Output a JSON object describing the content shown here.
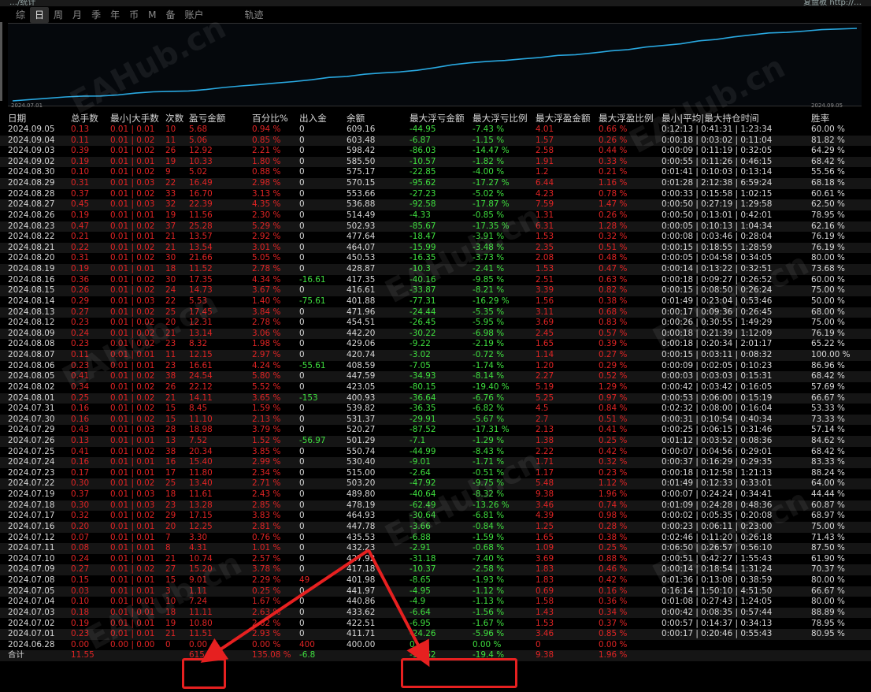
{
  "topbar": {
    "left_title": "…/统计",
    "right_title": "复盘板 http://…"
  },
  "tabs": [
    "综",
    "日",
    "周",
    "月",
    "季",
    "年",
    "币",
    "M",
    "备",
    "账户",
    "轨迹"
  ],
  "active_tab": "日",
  "chart": {
    "start_date": "2024.07.01",
    "end_date": "2024.09.05",
    "line_color": "#29a8e0"
  },
  "watermark": "EAHub.cn",
  "columns": [
    "日期",
    "总手数",
    "最小|大手数",
    "次数",
    "盈亏金额",
    "百分比%",
    "出入金",
    "余额",
    "最大浮亏金额",
    "最大浮亏比例",
    "最大浮盈金额",
    "最大浮盈比例",
    "最小|平均|最大持仓时间",
    "胜率"
  ],
  "rows": [
    [
      "2024.09.05",
      "0.13",
      "0.01 | 0.01",
      "10",
      "5.68",
      "0.94 %",
      "0",
      "609.16",
      "-44.95",
      "-7.43 %",
      "4.01",
      "0.66 %",
      "0:12:13 | 0:41:31 | 1:23:34",
      "60.00 %"
    ],
    [
      "2024.09.04",
      "0.11",
      "0.01 | 0.02",
      "11",
      "5.06",
      "0.85 %",
      "0",
      "603.48",
      "-6.87",
      "-1.15 %",
      "1.57",
      "0.26 %",
      "0:00:18 | 0:03:02 | 0:11:04",
      "81.82 %"
    ],
    [
      "2024.09.03",
      "0.39",
      "0.01 | 0.02",
      "26",
      "12.92",
      "2.21 %",
      "0",
      "598.42",
      "-86.03",
      "-14.47 %",
      "2.58",
      "0.44 %",
      "0:00:09 | 0:11:19 | 0:32:05",
      "64.29 %"
    ],
    [
      "2024.09.02",
      "0.19",
      "0.01 | 0.01",
      "19",
      "10.33",
      "1.80 %",
      "0",
      "585.50",
      "-10.57",
      "-1.82 %",
      "1.91",
      "0.33 %",
      "0:00:55 | 0:11:26 | 0:46:15",
      "68.42 %"
    ],
    [
      "2024.08.30",
      "0.10",
      "0.01 | 0.02",
      "9",
      "5.02",
      "0.88 %",
      "0",
      "575.17",
      "-22.85",
      "-4.00 %",
      "1.2",
      "0.21 %",
      "0:01:41 | 0:10:03 | 0:13:14",
      "55.56 %"
    ],
    [
      "2024.08.29",
      "0.31",
      "0.01 | 0.03",
      "22",
      "16.49",
      "2.98 %",
      "0",
      "570.15",
      "-95.62",
      "-17.27 %",
      "6.44",
      "1.16 %",
      "0:01:28 | 2:12:38 | 6:59:24",
      "68.18 %"
    ],
    [
      "2024.08.28",
      "0.37",
      "0.01 | 0.02",
      "33",
      "16.70",
      "3.13 %",
      "0",
      "553.66",
      "-27.23",
      "-5.02 %",
      "4.23",
      "0.78 %",
      "0:00:33 | 0:15:58 | 1:02:15",
      "60.61 %"
    ],
    [
      "2024.08.27",
      "0.45",
      "0.01 | 0.03",
      "32",
      "22.39",
      "4.35 %",
      "0",
      "536.88",
      "-92.58",
      "-17.87 %",
      "7.59",
      "1.47 %",
      "0:00:50 | 0:27:19 | 1:29:58",
      "62.50 %"
    ],
    [
      "2024.08.26",
      "0.19",
      "0.01 | 0.01",
      "19",
      "11.56",
      "2.30 %",
      "0",
      "514.49",
      "-4.33",
      "-0.85 %",
      "1.31",
      "0.26 %",
      "0:00:50 | 0:13:01 | 0:42:01",
      "78.95 %"
    ],
    [
      "2024.08.23",
      "0.47",
      "0.01 | 0.02",
      "37",
      "25.28",
      "5.29 %",
      "0",
      "502.93",
      "-85.67",
      "-17.35 %",
      "6.31",
      "1.28 %",
      "0:00:05 | 0:10:13 | 1:04:34",
      "62.16 %"
    ],
    [
      "2024.08.22",
      "0.21",
      "0.01 | 0.01",
      "21",
      "13.57",
      "2.92 %",
      "0",
      "477.64",
      "-18.47",
      "-3.91 %",
      "1.53",
      "0.32 %",
      "0:00:08 | 0:03:46 | 0:28:04",
      "76.19 %"
    ],
    [
      "2024.08.21",
      "0.22",
      "0.01 | 0.02",
      "21",
      "13.54",
      "3.01 %",
      "0",
      "464.07",
      "-15.99",
      "-3.48 %",
      "2.35",
      "0.51 %",
      "0:00:15 | 0:18:55 | 1:28:59",
      "76.19 %"
    ],
    [
      "2024.08.20",
      "0.31",
      "0.01 | 0.02",
      "30",
      "21.66",
      "5.05 %",
      "0",
      "450.53",
      "-16.35",
      "-3.73 %",
      "2.08",
      "0.48 %",
      "0:00:05 | 0:04:58 | 0:34:05",
      "80.00 %"
    ],
    [
      "2024.08.19",
      "0.19",
      "0.01 | 0.01",
      "18",
      "11.52",
      "2.78 %",
      "0",
      "428.87",
      "-10.3",
      "-2.41 %",
      "1.53",
      "0.47 %",
      "0:00:14 | 0:13:22 | 0:32:51",
      "73.68 %"
    ],
    [
      "2024.08.16",
      "0.36",
      "0.01 | 0.02",
      "30",
      "17.35",
      "4.34 %",
      "-16.61",
      "417.35",
      "-40.16",
      "-9.85 %",
      "2.51",
      "0.63 %",
      "0:00:18 | 0:09:27 | 0:26:52",
      "60.00 %"
    ],
    [
      "2024.08.15",
      "0.26",
      "0.01 | 0.02",
      "24",
      "14.73",
      "3.67 %",
      "0",
      "416.61",
      "-33.87",
      "-8.21 %",
      "3.39",
      "0.82 %",
      "0:00:15 | 0:08:50 | 0:26:24",
      "75.00 %"
    ],
    [
      "2024.08.14",
      "0.29",
      "0.01 | 0.03",
      "22",
      "5.53",
      "1.40 %",
      "-75.61",
      "401.88",
      "-77.31",
      "-16.29 %",
      "1.56",
      "0.38 %",
      "0:01:49 | 0:23:04 | 0:53:46",
      "50.00 %"
    ],
    [
      "2024.08.13",
      "0.27",
      "0.01 | 0.02",
      "25",
      "17.45",
      "3.84 %",
      "0",
      "471.96",
      "-24.44",
      "-5.35 %",
      "3.11",
      "0.68 %",
      "0:00:17 | 0:09:36 | 0:26:45",
      "68.00 %"
    ],
    [
      "2024.08.12",
      "0.23",
      "0.01 | 0.02",
      "20",
      "12.31",
      "2.78 %",
      "0",
      "454.51",
      "-26.45",
      "-5.95 %",
      "3.69",
      "0.83 %",
      "0:00:26 | 0:30:55 | 1:49:29",
      "75.00 %"
    ],
    [
      "2024.08.09",
      "0.24",
      "0.01 | 0.02",
      "21",
      "13.14",
      "3.06 %",
      "0",
      "442.20",
      "-30.22",
      "-6.98 %",
      "2.45",
      "0.57 %",
      "0:00:18 | 0:21:39 | 1:12:09",
      "76.19 %"
    ],
    [
      "2024.08.08",
      "0.23",
      "0.01 | 0.02",
      "23",
      "8.32",
      "1.98 %",
      "0",
      "429.06",
      "-9.22",
      "-2.19 %",
      "1.65",
      "0.39 %",
      "0:00:18 | 0:20:34 | 2:01:17",
      "65.22 %"
    ],
    [
      "2024.08.07",
      "0.11",
      "0.01 | 0.01",
      "11",
      "12.15",
      "2.97 %",
      "0",
      "420.74",
      "-3.02",
      "-0.72 %",
      "1.14",
      "0.27 %",
      "0:00:15 | 0:03:11 | 0:08:32",
      "100.00 %"
    ],
    [
      "2024.08.06",
      "0.23",
      "0.01 | 0.01",
      "23",
      "16.61",
      "4.24 %",
      "-55.61",
      "408.59",
      "-7.05",
      "-1.74 %",
      "1.20",
      "0.29 %",
      "0:00:09 | 0:02:05 | 0:10:23",
      "86.96 %"
    ],
    [
      "2024.08.05",
      "0.41",
      "0.01 | 0.02",
      "38",
      "24.54",
      "5.80 %",
      "0",
      "447.59",
      "-34.93",
      "-8.14 %",
      "2.27",
      "0.52 %",
      "0:00:03 | 0:03:03 | 0:15:31",
      "68.42 %"
    ],
    [
      "2024.08.02",
      "0.34",
      "0.01 | 0.02",
      "26",
      "22.12",
      "5.52 %",
      "0",
      "423.05",
      "-80.15",
      "-19.40 %",
      "5.19",
      "1.29 %",
      "0:00:42 | 0:03:42 | 0:16:05",
      "57.69 %"
    ],
    [
      "2024.08.01",
      "0.25",
      "0.01 | 0.02",
      "21",
      "14.11",
      "3.65 %",
      "-153",
      "400.93",
      "-36.64",
      "-6.76 %",
      "5.25",
      "0.97 %",
      "0:00:53 | 0:06:00 | 0:15:19",
      "66.67 %"
    ],
    [
      "2024.07.31",
      "0.16",
      "0.01 | 0.02",
      "15",
      "8.45",
      "1.59 %",
      "0",
      "539.82",
      "-36.35",
      "-6.82 %",
      "4.5",
      "0.84 %",
      "0:02:32 | 0:08:00 | 0:16:04",
      "53.33 %"
    ],
    [
      "2024.07.30",
      "0.16",
      "0.01 | 0.02",
      "15",
      "11.10",
      "2.13 %",
      "0",
      "531.37",
      "-29.91",
      "-5.67 %",
      "2.7",
      "0.51 %",
      "0:00:31 | 0:10:54 | 0:40:34",
      "73.33 %"
    ],
    [
      "2024.07.29",
      "0.43",
      "0.01 | 0.03",
      "28",
      "18.98",
      "3.79 %",
      "0",
      "520.27",
      "-87.52",
      "-17.31 %",
      "2.13",
      "0.41 %",
      "0:00:25 | 0:06:15 | 0:31:46",
      "57.14 %"
    ],
    [
      "2024.07.26",
      "0.13",
      "0.01 | 0.01",
      "13",
      "7.52",
      "1.52 %",
      "-56.97",
      "501.29",
      "-7.1",
      "-1.29 %",
      "1.38",
      "0.25 %",
      "0:01:12 | 0:03:52 | 0:08:36",
      "84.62 %"
    ],
    [
      "2024.07.25",
      "0.41",
      "0.01 | 0.02",
      "38",
      "20.34",
      "3.85 %",
      "0",
      "550.74",
      "-44.99",
      "-8.43 %",
      "2.22",
      "0.42 %",
      "0:00:07 | 0:04:56 | 0:29:01",
      "68.42 %"
    ],
    [
      "2024.07.24",
      "0.16",
      "0.01 | 0.01",
      "16",
      "15.40",
      "2.99 %",
      "0",
      "530.40",
      "-9.01",
      "-1.71 %",
      "1.71",
      "0.32 %",
      "0:00:37 | 0:16:29 | 0:29:35",
      "83.33 %"
    ],
    [
      "2024.07.23",
      "0.17",
      "0.01 | 0.01",
      "17",
      "11.80",
      "2.34 %",
      "0",
      "515.00",
      "-2.64",
      "-0.51 %",
      "1.17",
      "0.23 %",
      "0:00:18 | 0:12:58 | 1:21:13",
      "88.24 %"
    ],
    [
      "2024.07.22",
      "0.30",
      "0.01 | 0.02",
      "25",
      "13.40",
      "2.71 %",
      "0",
      "503.20",
      "-47.92",
      "-9.75 %",
      "5.48",
      "1.12 %",
      "0:01:49 | 0:12:33 | 0:33:01",
      "64.00 %"
    ],
    [
      "2024.07.19",
      "0.37",
      "0.01 | 0.03",
      "18",
      "11.61",
      "2.43 %",
      "0",
      "489.80",
      "-40.64",
      "-8.32 %",
      "9.38",
      "1.96 %",
      "0:00:07 | 0:24:24 | 0:34:41",
      "44.44 %"
    ],
    [
      "2024.07.18",
      "0.30",
      "0.01 | 0.03",
      "23",
      "13.28",
      "2.85 %",
      "0",
      "478.19",
      "-62.49",
      "-13.26 %",
      "3.46",
      "0.74 %",
      "0:01:09 | 0:24:28 | 0:48:36",
      "60.87 %"
    ],
    [
      "2024.07.17",
      "0.32",
      "0.01 | 0.02",
      "29",
      "17.15",
      "3.83 %",
      "0",
      "464.93",
      "-30.64",
      "-6.81 %",
      "4.39",
      "0.98 %",
      "0:00:02 | 0:05:35 | 0:20:08",
      "68.97 %"
    ],
    [
      "2024.07.16",
      "0.20",
      "0.01 | 0.01",
      "20",
      "12.25",
      "2.81 %",
      "0",
      "447.78",
      "-3.66",
      "-0.84 %",
      "1.25",
      "0.28 %",
      "0:00:23 | 0:06:11 | 0:23:00",
      "75.00 %"
    ],
    [
      "2024.07.12",
      "0.07",
      "0.01 | 0.01",
      "7",
      "3.30",
      "0.76 %",
      "0",
      "435.53",
      "-6.88",
      "-1.59 %",
      "1.65",
      "0.38 %",
      "0:02:46 | 0:11:20 | 0:26:18",
      "71.43 %"
    ],
    [
      "2024.07.11",
      "0.08",
      "0.01 | 0.01",
      "8",
      "4.31",
      "1.01 %",
      "0",
      "432.23",
      "-2.91",
      "-0.68 %",
      "1.09",
      "0.25 %",
      "0:06:50 | 0:26:57 | 0:56:10",
      "87.50 %"
    ],
    [
      "2024.07.10",
      "0.24",
      "0.01 | 0.01",
      "21",
      "10.74",
      "2.57 %",
      "0",
      "427.92",
      "-31.18",
      "-7.40 %",
      "3.69",
      "0.88 %",
      "0:00:51 | 0:42:27 | 1:55:43",
      "61.90 %"
    ],
    [
      "2024.07.09",
      "0.27",
      "0.01 | 0.02",
      "27",
      "15.20",
      "3.78 %",
      "0",
      "417.18",
      "-10.37",
      "-2.58 %",
      "1.83",
      "0.46 %",
      "0:00:14 | 0:18:54 | 1:31:24",
      "70.37 %"
    ],
    [
      "2024.07.08",
      "0.15",
      "0.01 | 0.01",
      "15",
      "9.01",
      "2.29 %",
      "49",
      "401.98",
      "-8.65",
      "-1.93 %",
      "1.83",
      "0.42 %",
      "0:01:36 | 0:13:08 | 0:38:59",
      "80.00 %"
    ],
    [
      "2024.07.05",
      "0.03",
      "0.01 | 0.01",
      "3",
      "1.11",
      "0.25 %",
      "0",
      "441.97",
      "-4.95",
      "-1.12 %",
      "0.69",
      "0.16 %",
      "0:16:14 | 1:50:10 | 4:51:50",
      "66.67 %"
    ],
    [
      "2024.07.04",
      "0.10",
      "0.01 | 0.01",
      "10",
      "7.24",
      "1.67 %",
      "0",
      "440.86",
      "-4.9",
      "-1.13 %",
      "1.58",
      "0.36 %",
      "0:01:08 | 0:27:43 | 1:24:05",
      "80.00 %"
    ],
    [
      "2024.07.03",
      "0.18",
      "0.01 | 0.01",
      "18",
      "11.11",
      "2.63 %",
      "0",
      "433.62",
      "-6.64",
      "-1.56 %",
      "1.43",
      "0.34 %",
      "0:00:42 | 0:08:35 | 0:57:44",
      "88.89 %"
    ],
    [
      "2024.07.02",
      "0.19",
      "0.01 | 0.01",
      "19",
      "10.80",
      "2.62 %",
      "0",
      "422.51",
      "-6.95",
      "-1.67 %",
      "1.53",
      "0.37 %",
      "0:00:57 | 0:14:37 | 0:34:13",
      "78.95 %"
    ],
    [
      "2024.07.01",
      "0.23",
      "0.01 | 0.01",
      "21",
      "11.51",
      "2.93 %",
      "0",
      "411.71",
      "-24.26",
      "-5.96 %",
      "3.46",
      "0.85 %",
      "0:00:17 | 0:20:46 | 0:55:43",
      "80.95 %"
    ],
    [
      "2024.06.28",
      "0.00",
      "0.00 | 0.00",
      "0",
      "0.00",
      "0.00 %",
      "400",
      "400.00",
      "0",
      "0.00 %",
      "0",
      "0.00 %",
      "",
      ""
    ]
  ],
  "total": [
    "合计",
    "11.55",
    "",
    "",
    "615.96",
    "135.08 %",
    "-6.8",
    "",
    "-95.62",
    "-19.4 %",
    "9.38",
    "1.96 %",
    "",
    ""
  ]
}
